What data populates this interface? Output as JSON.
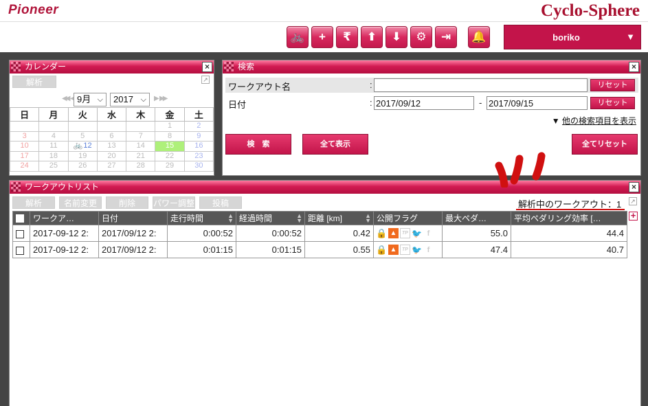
{
  "header": {
    "brand": "Pioneer",
    "product": "Cyclo-Sphere",
    "user": "boriko",
    "toolbar_icons": [
      "bike-icon",
      "plus-icon",
      "yen-icon",
      "upload-icon",
      "download-icon",
      "gear-icon",
      "logout-icon",
      "bell-icon"
    ],
    "glyphs": {
      "bike": "🚲",
      "plus": "+",
      "yen": "₹",
      "up": "⬆",
      "down": "⬇",
      "gear": "⚙",
      "logout": "⇥",
      "bell": "🔔",
      "caret": "▼"
    }
  },
  "calendar": {
    "title": "カレンダー",
    "analyze_label": "解析",
    "month": "9月",
    "year": "2017",
    "weekdays": [
      "日",
      "月",
      "火",
      "水",
      "木",
      "金",
      "土"
    ],
    "weeks": [
      [
        "",
        "",
        "",
        "",
        "",
        "1",
        "2"
      ],
      [
        "3",
        "4",
        "5",
        "6",
        "7",
        "8",
        "9"
      ],
      [
        "10",
        "11",
        "12",
        "13",
        "14",
        "15",
        "16"
      ],
      [
        "17",
        "18",
        "19",
        "20",
        "21",
        "22",
        "23"
      ],
      [
        "24",
        "25",
        "26",
        "27",
        "28",
        "29",
        "30"
      ]
    ],
    "today": "15",
    "ride_day": "12"
  },
  "search": {
    "title": "検索",
    "workout_name_label": "ワークアウト名",
    "workout_name_value": "",
    "date_label": "日付",
    "date_from": "2017/09/12",
    "date_to": "2017/09/15",
    "colon": ":",
    "dash": "-",
    "reset_label": "リセット",
    "more_prefix": "▼",
    "more_label": "他の検索項目を表示",
    "search_button": "検　索",
    "show_all_button": "全て表示",
    "reset_all_button": "全てリセット"
  },
  "workouts": {
    "title": "ワークアウトリスト",
    "actions": [
      "解析",
      "名前変更",
      "削除",
      "パワー調整",
      "投稿"
    ],
    "analyzing_label": "解析中のワークアウト：1",
    "columns": [
      "ワークア…",
      "日付",
      "走行時間",
      "経過時間",
      "距離 [km]",
      "公開フラグ",
      "最大ペダ…",
      "平均ペダリング効率 […"
    ],
    "rows": [
      {
        "name": "2017-09-12 2:",
        "date": "2017/09/12 2:",
        "ride_time": "0:00:52",
        "elapsed": "0:00:52",
        "distance": "0.42",
        "max_pedal": "55.0",
        "avg_eff": "44.4"
      },
      {
        "name": "2017-09-12 2:",
        "date": "2017/09/12 2:",
        "ride_time": "0:01:15",
        "elapsed": "0:01:15",
        "distance": "0.55",
        "max_pedal": "47.4",
        "avg_eff": "40.7"
      }
    ]
  },
  "colors": {
    "accent": "#c3144a",
    "today": "#aef07a",
    "annotation": "#d01010"
  }
}
